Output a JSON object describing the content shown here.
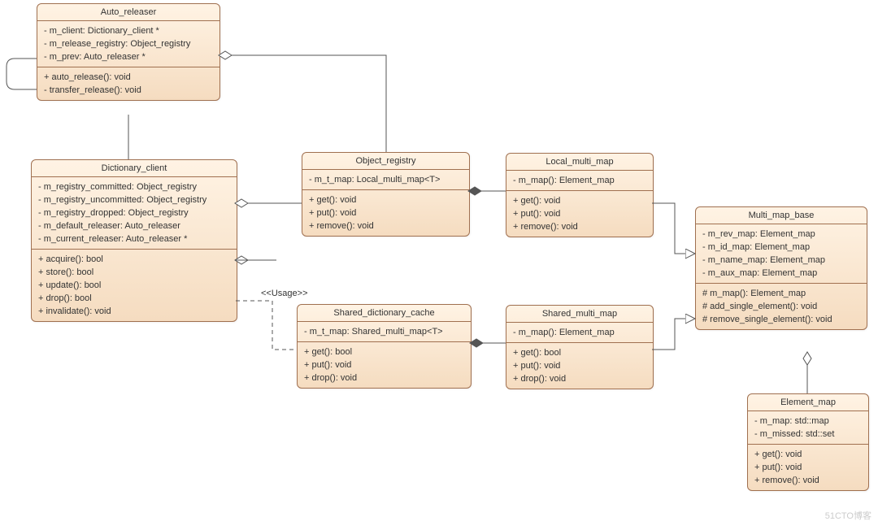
{
  "stereotype": {
    "usage": "<<Usage>>"
  },
  "watermark": "51CTO博客",
  "classes": {
    "auto_releaser": {
      "name": "Auto_releaser",
      "attrs": [
        "- m_client: Dictionary_client *",
        "- m_release_registry: Object_registry",
        "- m_prev: Auto_releaser *"
      ],
      "ops": [
        "+ auto_release(): void",
        "- transfer_release(): void"
      ]
    },
    "dictionary_client": {
      "name": "Dictionary_client",
      "attrs": [
        "- m_registry_committed: Object_registry",
        "- m_registry_uncommitted: Object_registry",
        "- m_registry_dropped: Object_registry",
        "- m_default_releaser: Auto_releaser",
        "- m_current_releaser: Auto_releaser *"
      ],
      "ops": [
        "+ acquire(): bool",
        "+ store(): bool",
        "+ update(): bool",
        "+ drop(): bool",
        "+ invalidate(): void"
      ]
    },
    "object_registry": {
      "name": "Object_registry",
      "attrs": [
        "- m_t_map: Local_multi_map<T>"
      ],
      "ops": [
        "+ get(): void",
        "+ put(): void",
        "+ remove(): void"
      ]
    },
    "local_multi_map": {
      "name": "Local_multi_map",
      "attrs": [
        "- m_map(): Element_map"
      ],
      "ops": [
        "+ get(): void",
        "+ put(): void",
        "+ remove(): void"
      ]
    },
    "shared_dictionary_cache": {
      "name": "Shared_dictionary_cache",
      "attrs": [
        "- m_t_map: Shared_multi_map<T>"
      ],
      "ops": [
        "+ get(): bool",
        "+ put(): void",
        "+ drop(): void"
      ]
    },
    "shared_multi_map": {
      "name": "Shared_multi_map",
      "attrs": [
        "- m_map(): Element_map"
      ],
      "ops": [
        "+ get(): bool",
        "+ put(): void",
        "+ drop(): void"
      ]
    },
    "multi_map_base": {
      "name": "Multi_map_base",
      "attrs": [
        "- m_rev_map: Element_map",
        "- m_id_map: Element_map",
        "- m_name_map: Element_map",
        "- m_aux_map: Element_map"
      ],
      "ops": [
        "# m_map(): Element_map",
        "# add_single_element(): void",
        "# remove_single_element(): void"
      ]
    },
    "element_map": {
      "name": "Element_map",
      "attrs": [
        "- m_map: std::map",
        "- m_missed: std::set"
      ],
      "ops": [
        "+ get(): void",
        "+ put(): void",
        "+ remove(): void"
      ]
    }
  }
}
